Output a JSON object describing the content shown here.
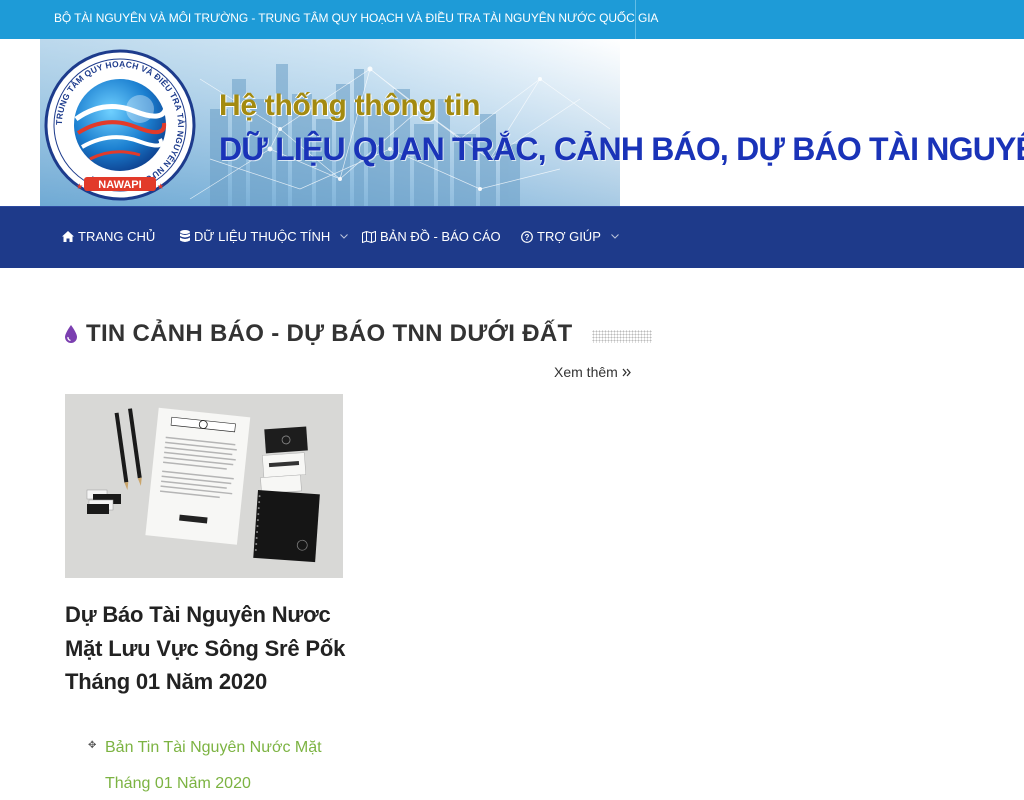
{
  "topbar": {
    "text": "BỘ TÀI NGUYÊN VÀ MÔI TRƯỜNG - TRUNG TÂM QUY HOẠCH VÀ ĐIỀU TRA TÀI NGUYÊN NƯỚC QUỐC GIA"
  },
  "banner": {
    "line1": "Hệ thống thông tin",
    "line2": "DỮ LIỆU QUAN TRẮC, CẢNH BÁO, DỰ BÁO TÀI NGUYÊN NƯỚC",
    "logo_text_ring": "TRUNG TÂM QUY HOẠCH VÀ ĐIỀU TRA TÀI NGUYÊN NƯỚC QUỐC GIA",
    "logo_label": "NAWAPI"
  },
  "nav": {
    "items": [
      {
        "label": "TRANG CHỦ",
        "icon": "home-icon"
      },
      {
        "label": "DỮ LIỆU THUỘC TÍNH",
        "icon": "database-icon",
        "has_dropdown": true
      },
      {
        "label": "BẢN ĐỒ - BÁO CÁO",
        "icon": "map-icon"
      },
      {
        "label": "TRỢ GIÚP",
        "icon": "help-icon",
        "has_dropdown": true
      }
    ]
  },
  "section": {
    "title": "TIN CẢNH BÁO - DỰ BÁO TNN DƯỚI ĐẤT",
    "icon": "water-drop-icon",
    "more_label": "Xem thêm"
  },
  "article": {
    "title": "Dự Báo Tài Nguyên Nươc Mặt Lưu Vực Sông Srê Pốk Tháng 01 Năm 2020",
    "related": [
      "Bản Tin Tài Nguyên Nước Mặt Tháng 01 Năm 2020"
    ]
  },
  "colors": {
    "topbar": "#1e9bd7",
    "nav": "#1e3a8a",
    "banner_title_gold": "#a38a10",
    "banner_title_blue": "#1a33b8",
    "drop_icon": "#7b3fb0",
    "related_link": "#7cb342"
  }
}
